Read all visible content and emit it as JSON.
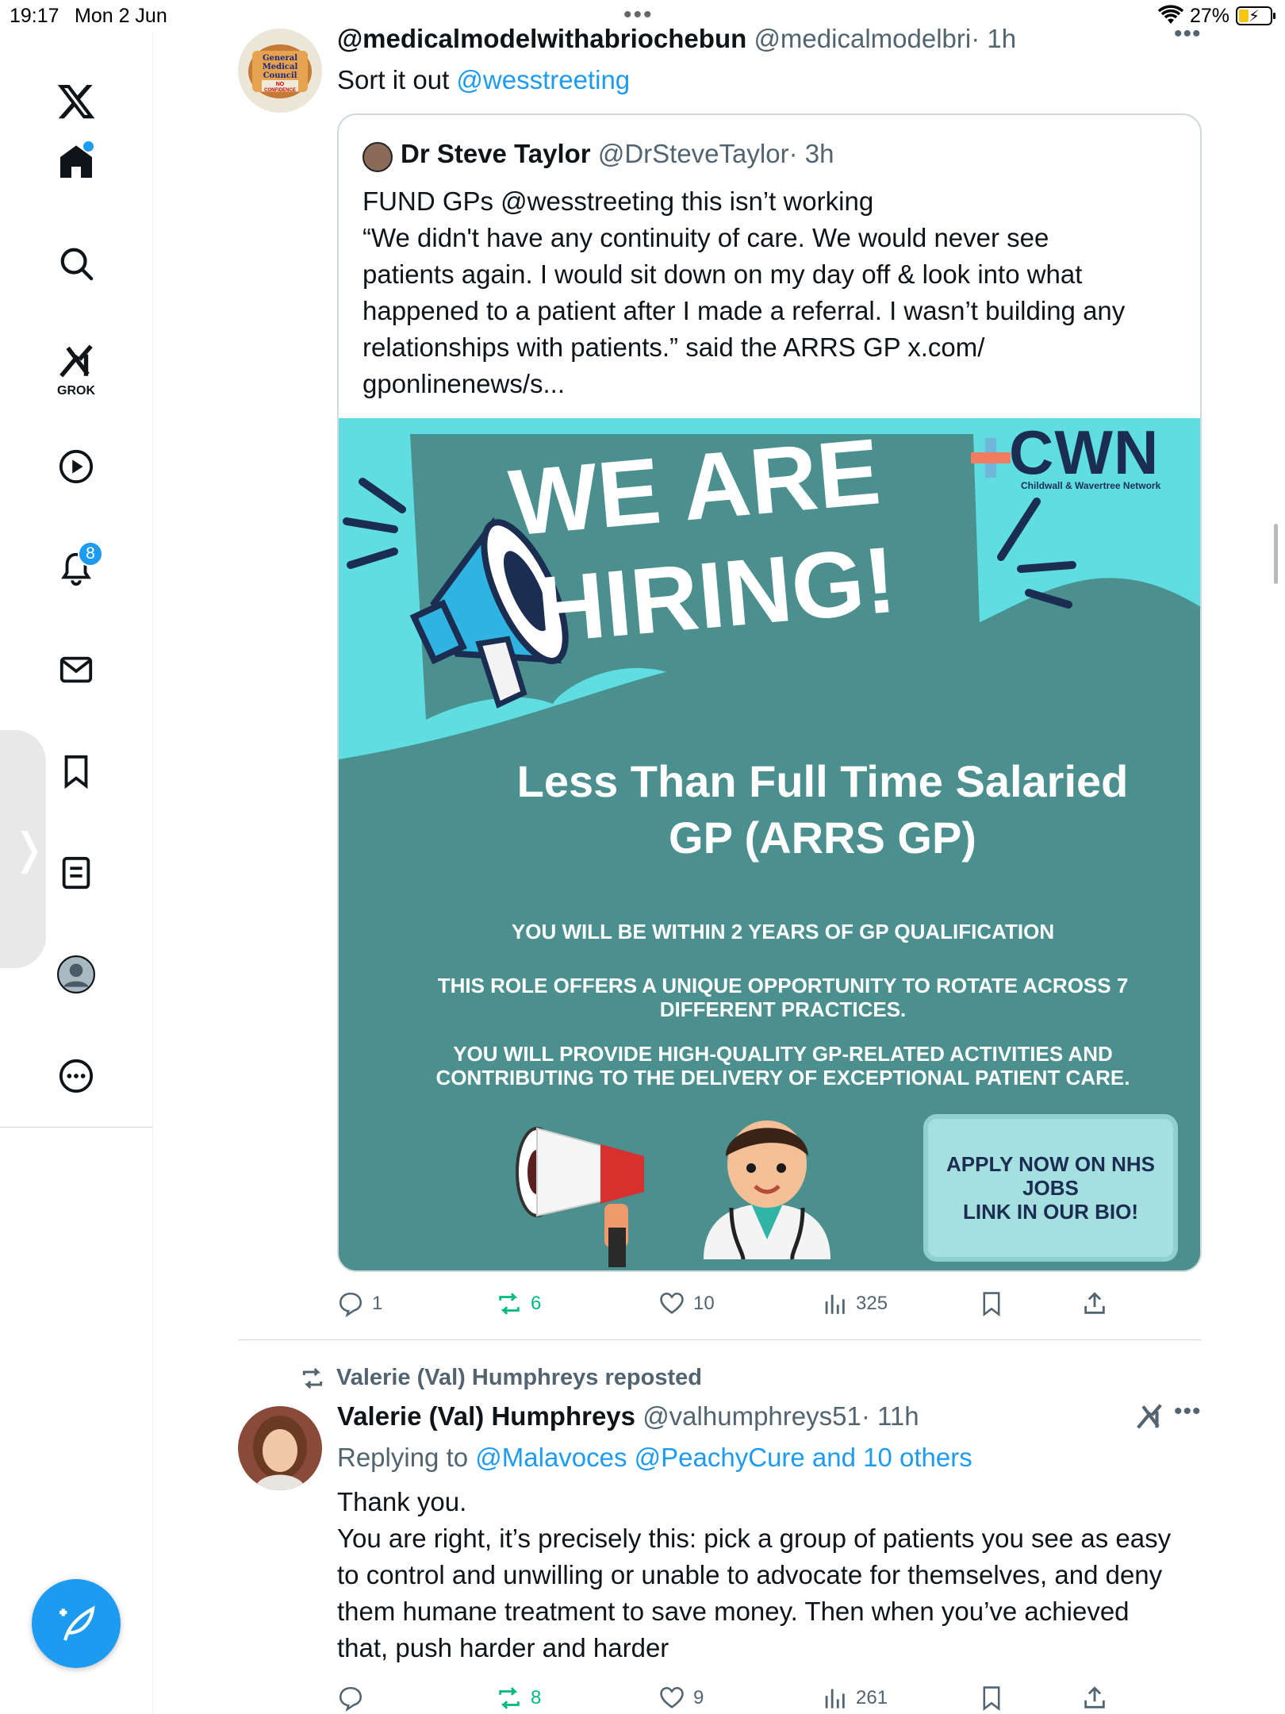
{
  "status_bar": {
    "time": "19:17",
    "date": "Mon 2 Jun",
    "battery": "27%"
  },
  "sidebar": {
    "grok_label": "GROK",
    "notifications_count": "8",
    "compose_label": "+"
  },
  "post1": {
    "display_name": "@medicalmodelwithabriochebun",
    "handle": "@medicalmodelbri",
    "time": "· 1h",
    "text_prefix": "Sort it out ",
    "text_mention": "@wesstreeting",
    "avatar_text": [
      "General",
      "Medical",
      "Council",
      "NO",
      "CONFIDENCE"
    ],
    "quote": {
      "display_name": "Dr Steve Taylor",
      "handle": "@DrSteveTaylor",
      "time": "· 3h",
      "lines": [
        "FUND GPs @wesstreeting this isn’t working",
        "“We didn't have any continuity of care. We would never see",
        "patients again. I would sit down on my day off & look into what",
        "happened to a patient after I made a referral. I wasn’t building any",
        "relationships with patients.” said the ARRS GP x.com/",
        "gponlinenews/s..."
      ]
    },
    "poster": {
      "logo": "CWN",
      "logo_sub": "Childwall & Wavertree Network",
      "headline_1": "WE ARE",
      "headline_2": "HIRING!",
      "role_1": "Less Than Full Time Salaried",
      "role_2": "GP (ARRS GP)",
      "line_1": "YOU WILL BE WITHIN 2 YEARS OF GP QUALIFICATION",
      "line_2a": "THIS ROLE OFFERS A UNIQUE OPPORTUNITY TO ROTATE ACROSS 7",
      "line_2b": "DIFFERENT PRACTICES.",
      "line_3a": "YOU WILL PROVIDE HIGH-QUALITY GP-RELATED ACTIVITIES AND",
      "line_3b": "CONTRIBUTING TO THE DELIVERY OF EXCEPTIONAL PATIENT CARE.",
      "apply_1": "APPLY NOW ON NHS",
      "apply_2": "JOBS",
      "apply_3": "LINK IN OUR BIO!"
    },
    "stats": {
      "replies": "1",
      "reposts": "6",
      "likes": "10",
      "views": "325"
    }
  },
  "post2": {
    "repost_note": "Valerie (Val) Humphreys reposted",
    "display_name": "Valerie (Val) Humphreys",
    "handle": "@valhumphreys51",
    "time": "· 11h",
    "replying_prefix": "Replying to ",
    "replying_targets": "@Malavoces @PeachyCure and 10 others",
    "lines": [
      "Thank you.",
      "You are right, it’s precisely this: pick a group of patients you see as easy",
      "to control and unwilling or unable to advocate for themselves, and deny",
      "them humane treatment to save money. Then when you’ve achieved",
      "that, push harder and harder"
    ],
    "stats": {
      "reposts": "8",
      "likes": "9",
      "views": "261"
    }
  },
  "colors": {
    "accent": "#1d9bf0",
    "repost": "#00ba7c",
    "muted": "#536471",
    "poster_teal": "#4b8f8e",
    "poster_cyan": "#5fdde0"
  }
}
